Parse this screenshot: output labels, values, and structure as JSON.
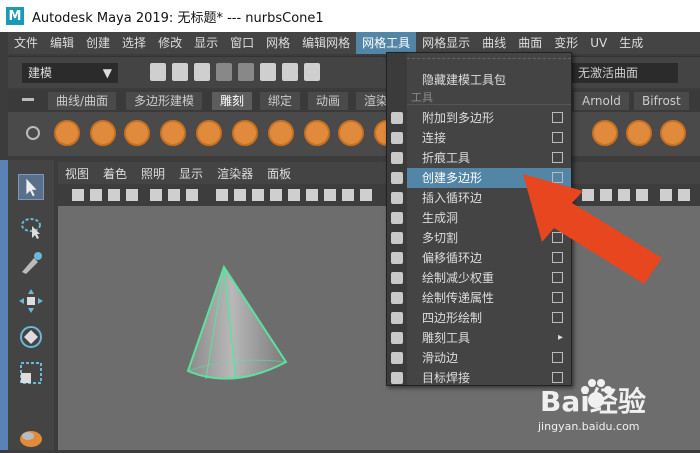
{
  "window": {
    "title": "Autodesk Maya 2019: 无标题*   ---   nurbsCone1",
    "logo_letter": "M"
  },
  "menubar": {
    "items": [
      "文件",
      "编辑",
      "创建",
      "选择",
      "修改",
      "显示",
      "窗口",
      "网格",
      "编辑网格",
      "网格工具",
      "网格显示",
      "曲线",
      "曲面",
      "变形",
      "UV",
      "生成"
    ],
    "active_index": 9
  },
  "statusline": {
    "mode": "建模",
    "nurbs_field": "无激活曲面"
  },
  "shelf": {
    "tabs": [
      "曲线/曲面",
      "多边形建模",
      "雕刻",
      "绑定",
      "动画",
      "渲染",
      "Arnold",
      "Bifrost"
    ],
    "active_tab": "雕刻"
  },
  "panel": {
    "menu": [
      "视图",
      "着色",
      "照明",
      "显示",
      "渲染器",
      "面板"
    ]
  },
  "dropdown": {
    "tearoff_label": "隐藏建模工具包",
    "section": "工具",
    "items": [
      {
        "label": "附加到多边形",
        "option": true,
        "highlight": false,
        "submenu": false
      },
      {
        "label": "连接",
        "option": true,
        "highlight": false,
        "submenu": false
      },
      {
        "label": "折痕工具",
        "option": true,
        "highlight": false,
        "submenu": false
      },
      {
        "label": "创建多边形",
        "option": true,
        "highlight": true,
        "submenu": false
      },
      {
        "label": "插入循环边",
        "option": false,
        "highlight": false,
        "submenu": false
      },
      {
        "label": "生成洞",
        "option": false,
        "highlight": false,
        "submenu": false
      },
      {
        "label": "多切割",
        "option": true,
        "highlight": false,
        "submenu": false
      },
      {
        "label": "偏移循环边",
        "option": true,
        "highlight": false,
        "submenu": false
      },
      {
        "label": "绘制减少权重",
        "option": true,
        "highlight": false,
        "submenu": false
      },
      {
        "label": "绘制传递属性",
        "option": true,
        "highlight": false,
        "submenu": false
      },
      {
        "label": "四边形绘制",
        "option": true,
        "highlight": false,
        "submenu": false
      },
      {
        "label": "雕刻工具",
        "option": false,
        "highlight": false,
        "submenu": true
      },
      {
        "label": "滑动边",
        "option": true,
        "highlight": false,
        "submenu": false
      },
      {
        "label": "目标焊接",
        "option": true,
        "highlight": false,
        "submenu": false
      }
    ],
    "submenu_glyph": "▸"
  },
  "watermark": {
    "brand": "Bai经验",
    "url": "jingyan.baidu.com"
  },
  "colors": {
    "highlight": "#5285a6",
    "arrow": "#e8461e",
    "cone_edge": "#5ee0a0"
  }
}
